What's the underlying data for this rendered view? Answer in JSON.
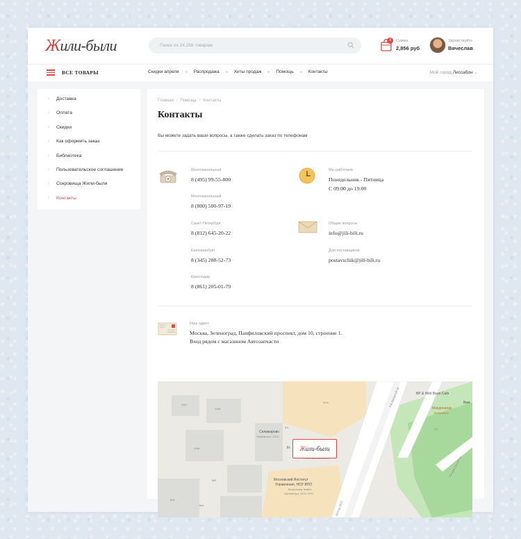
{
  "header": {
    "logo_first": "Ж",
    "logo_rest": "или-были",
    "search_placeholder": "Поиск по 24,256 товарам",
    "cart": {
      "badge": "3",
      "label": "Сумма",
      "value": "2,856 руб"
    },
    "user": {
      "greeting": "Здравствуйте",
      "name": "Вячеслав"
    }
  },
  "nav": {
    "all_products": "ВСЕ ТОВАРЫ",
    "items": [
      "Скидки апреля",
      "Распродажа",
      "Хиты продаж",
      "Помощь",
      "Контакты"
    ],
    "city_label": "Мой город",
    "city_value": "Лиссабон",
    "city_chevron": "⌄"
  },
  "sidebar": {
    "items": [
      "Доставка",
      "Оплата",
      "Скидки",
      "Как оформить заказ",
      "Библиотека",
      "Пользовательское соглашение",
      "Сокровища Жили-были",
      "Контакты"
    ],
    "active_index": 7
  },
  "content": {
    "breadcrumb": [
      "Главная",
      "Помощь",
      "Контакты"
    ],
    "breadcrumb_sep": "/",
    "title": "Контакты",
    "intro": "Вы можете задать ваши вопросы, а также сделать заказ по телефонам",
    "phones": [
      {
        "label": "Многоканальный",
        "value": "8 (495) 99-55-800"
      },
      {
        "label": "Многоканальный",
        "value": "8 (800) 500-97-19"
      },
      {
        "label": "Санкт-Петербург",
        "value": "8 (812) 645-20-22"
      },
      {
        "label": "Екатеринбург",
        "value": "8 (345) 288-52-73"
      },
      {
        "label": "Краснодар",
        "value": "8 (861) 205-01-79"
      }
    ],
    "hours": {
      "label": "Мы работаем",
      "line1": "Понедельник - Пятница",
      "line2": "С 09:00 до 19:00"
    },
    "emails": [
      {
        "label": "Общие вопросы",
        "value": "info@jili-bili.ru"
      },
      {
        "label": "Для поставщиков",
        "value": "postavschik@jili-bili.ru"
      }
    ],
    "address": {
      "label": "Наш адрес",
      "line1": "Москва, Зеленоград, Панфиловский проспект, дом 10, строение 1.",
      "line2": "Вход рядом с магазином Автозапчасти"
    }
  },
  "map": {
    "labels": {
      "bp": "BP & Wild Bean Cafe",
      "vim": "Вим",
      "mcd": "Макдоналдс",
      "mcd_en": "McDonald's",
      "selig": "Селижарово",
      "selig_en": "Selizharovo, ООО",
      "fresh_short": "Fr",
      "fresh_en": "Fresh Автозапчасти",
      "institute": "Московский Институт",
      "institute2": "Управления, НОУ ВПО",
      "institute_en": "Moskovskiy Institut",
      "institute_en2": "Upravleniya, NOU VPO",
      "b1": "10к7",
      "b2": "10к6",
      "b3": "10к8",
      "b4": "9/15",
      "b5": "8к9",
      "b6": "8к8",
      "b7": "8к4",
      "b8": "2А",
      "road1": "проезд 4922",
      "road2": "Панфиловский пр",
      "road3": "3-й Западный пр",
      "mk": "9/1"
    },
    "marker_first": "Ж",
    "marker_rest": "или-были"
  },
  "colors": {
    "accent": "#e04848",
    "bg": "#f4f5f7"
  }
}
